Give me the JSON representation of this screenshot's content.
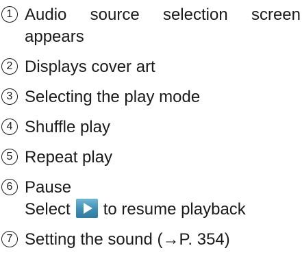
{
  "items": [
    {
      "num": "1",
      "line1": "Audio source selection screen",
      "line2": "appears"
    },
    {
      "num": "2",
      "line1": "Displays cover art"
    },
    {
      "num": "3",
      "line1": "Selecting the play mode"
    },
    {
      "num": "4",
      "line1": "Shuffle play"
    },
    {
      "num": "5",
      "line1": "Repeat play"
    },
    {
      "num": "6",
      "line1": "Pause",
      "line2_pre": "Select",
      "line2_post": "to resume playback",
      "icon": "play-icon"
    },
    {
      "num": "7",
      "line1": "Setting the sound (→P. 354)"
    }
  ],
  "colors": {
    "text": "#1a1a1a",
    "play_button": "#3f8fb3"
  }
}
